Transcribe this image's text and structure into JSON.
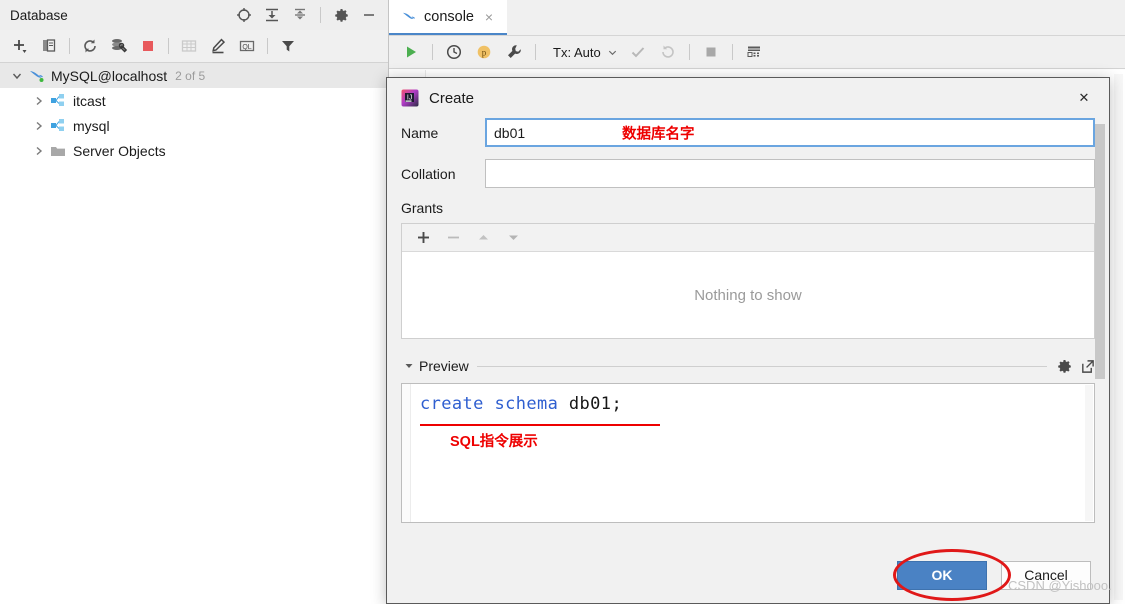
{
  "database_panel": {
    "title": "Database",
    "header_icons": [
      {
        "name": "locate-icon",
        "glyph": "crosshair"
      },
      {
        "name": "expand-all-icon",
        "glyph": "expand"
      },
      {
        "name": "collapse-all-icon",
        "glyph": "collapse"
      },
      {
        "name": "settings-gear-icon",
        "glyph": "gear"
      },
      {
        "name": "minimize-icon",
        "glyph": "minus"
      }
    ],
    "toolbar_icons": [
      {
        "name": "add-icon",
        "glyph": "plus-dropdown"
      },
      {
        "name": "duplicate-icon",
        "glyph": "copy"
      },
      {
        "name": "refresh-icon",
        "glyph": "refresh"
      },
      {
        "name": "sync-settings-icon",
        "glyph": "sync-wrench"
      },
      {
        "name": "stop-icon",
        "glyph": "stop-red"
      },
      {
        "name": "table-icon",
        "glyph": "grid"
      },
      {
        "name": "edit-icon",
        "glyph": "pencil"
      },
      {
        "name": "query-console-icon",
        "glyph": "ql"
      },
      {
        "name": "filter-icon",
        "glyph": "funnel"
      }
    ],
    "tree": [
      {
        "label": "MySQL@localhost",
        "count": "2 of 5",
        "icon": "mysql-dolphin-icon",
        "level": 0,
        "expanded": true,
        "selected": true
      },
      {
        "label": "itcast",
        "count": "",
        "icon": "schema-icon",
        "level": 1,
        "expanded": false,
        "selected": false
      },
      {
        "label": "mysql",
        "count": "",
        "icon": "schema-icon",
        "level": 1,
        "expanded": false,
        "selected": false
      },
      {
        "label": "Server Objects",
        "count": "",
        "icon": "folder-icon",
        "level": 1,
        "expanded": false,
        "selected": false
      }
    ]
  },
  "console": {
    "tab_label": "console",
    "tab_icon": "mysql-dolphin-icon",
    "tab_close": "×",
    "toolbar": {
      "tx_label": "Tx: Auto",
      "icons": [
        {
          "name": "execute-icon",
          "glyph": "play"
        },
        {
          "name": "history-icon",
          "glyph": "clock"
        },
        {
          "name": "parameters-icon",
          "glyph": "p-circle"
        },
        {
          "name": "settings-wrench-icon",
          "glyph": "wrench"
        },
        {
          "name": "commit-icon",
          "glyph": "check"
        },
        {
          "name": "rollback-icon",
          "glyph": "rollback"
        },
        {
          "name": "stop-icon",
          "glyph": "stop-gray"
        },
        {
          "name": "data-grid-icon",
          "glyph": "grid-lines"
        }
      ]
    }
  },
  "dialog": {
    "title": "Create",
    "close_label": "✕",
    "name": {
      "label": "Name",
      "value": "db01",
      "annotation": "数据库名字"
    },
    "collation": {
      "label": "Collation",
      "value": ""
    },
    "grants": {
      "label": "Grants",
      "empty_text": "Nothing to show",
      "toolbar": [
        {
          "name": "add-grant-button",
          "glyph": "plus",
          "enabled": true
        },
        {
          "name": "remove-grant-button",
          "glyph": "minus",
          "enabled": false
        },
        {
          "name": "move-up-button",
          "glyph": "up",
          "enabled": false
        },
        {
          "name": "move-down-button",
          "glyph": "down",
          "enabled": false
        }
      ]
    },
    "preview": {
      "label": "Preview",
      "sql_keyword": "create schema",
      "sql_identifier": " db01;",
      "annotation": "SQL指令展示",
      "icons": [
        {
          "name": "preview-settings-gear-icon",
          "glyph": "gear"
        },
        {
          "name": "open-in-editor-icon",
          "glyph": "external-link"
        }
      ]
    },
    "buttons": {
      "ok": "OK",
      "cancel": "Cancel"
    }
  },
  "watermark": "CSDN @Yishooo.",
  "colors": {
    "accent_blue": "#4a82c4",
    "annotation_red": "#ee0000",
    "keyword_blue": "#2f5fd0",
    "panel_gray": "#f0f0f0",
    "dialog_gray": "#f1f1f1",
    "stop_red": "#e85a5a",
    "tree_selection": "#e8e8e8"
  }
}
